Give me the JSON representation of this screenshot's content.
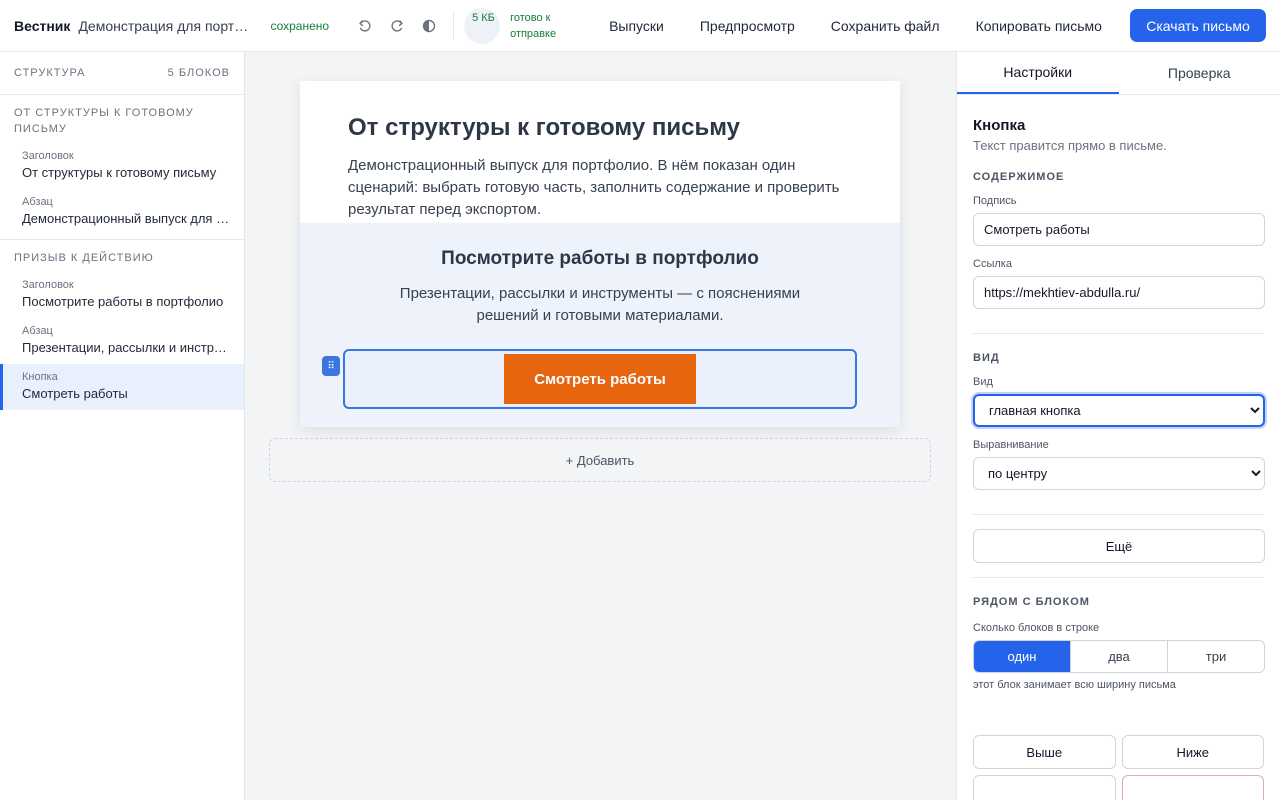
{
  "topbar": {
    "brand": "Вестник",
    "doc_title": "Демонстрация для портфолио",
    "saved_status": "сохранено",
    "size_badge": "5 КБ",
    "ready_status": "готово к отправке",
    "nav": [
      "Выпуски",
      "Предпросмотр",
      "Сохранить файл",
      "Копировать письмо"
    ],
    "download_label": "Скачать письмо",
    "icons": [
      "undo-icon",
      "redo-icon",
      "contrast-icon"
    ]
  },
  "sidebar": {
    "header": "СТРУКТУРА",
    "count": "5 БЛОКОВ",
    "groups": [
      {
        "title": "ОТ СТРУКТУРЫ К ГОТОВОМУ ПИСЬМУ",
        "items": [
          {
            "type": "Заголовок",
            "label": "От структуры к готовому письму"
          },
          {
            "type": "Абзац",
            "label": "Демонстрационный выпуск для портфолио"
          }
        ]
      },
      {
        "title": "ПРИЗЫВ К ДЕЙСТВИЮ",
        "items": [
          {
            "type": "Заголовок",
            "label": "Посмотрите работы в портфолио"
          },
          {
            "type": "Абзац",
            "label": "Презентации, рассылки и инструменты"
          },
          {
            "type": "Кнопка",
            "label": "Смотреть работы"
          }
        ]
      }
    ]
  },
  "letter": {
    "title": "От структуры к готовому письму",
    "intro": "Демонстрационный выпуск для портфолио. В нём показан один сценарий: выбрать готовую часть, заполнить содержание и проверить результат перед экспортом.",
    "cta_title": "Посмотрите работы в портфолио",
    "cta_text": "Презентации, рассылки и инструменты — с пояснениями решений и готовыми материалами.",
    "button_label": "Смотреть работы",
    "button_color": "#e8650f",
    "add_label": "+ Добавить"
  },
  "panel": {
    "tabs": [
      "Настройки",
      "Проверка"
    ],
    "active_tab": "Настройки",
    "block_title": "Кнопка",
    "block_hint": "Текст правится прямо в письме.",
    "content_section": "СОДЕРЖИМОЕ",
    "caption_label": "Подпись",
    "caption_value": "Смотреть работы",
    "link_label": "Ссылка",
    "link_value": "https://mekhtiev-abdulla.ru/",
    "view_section": "ВИД",
    "style_label": "Вид",
    "style_value": "главная кнопка",
    "align_label": "Выравнивание",
    "align_value": "по центру",
    "more_label": "Ещё",
    "beside_section": "РЯДОМ С БЛОКОМ",
    "per_row_label": "Сколько блоков в строке",
    "per_row_options": [
      "один",
      "два",
      "три"
    ],
    "per_row_selected": "один",
    "per_row_hint": "этот блок занимает всю ширину письма",
    "up_label": "Выше",
    "down_label": "Ниже"
  },
  "colors": {
    "accent": "#2563eb",
    "cta_background": "#eef3fb",
    "saved_green": "#15803d"
  }
}
